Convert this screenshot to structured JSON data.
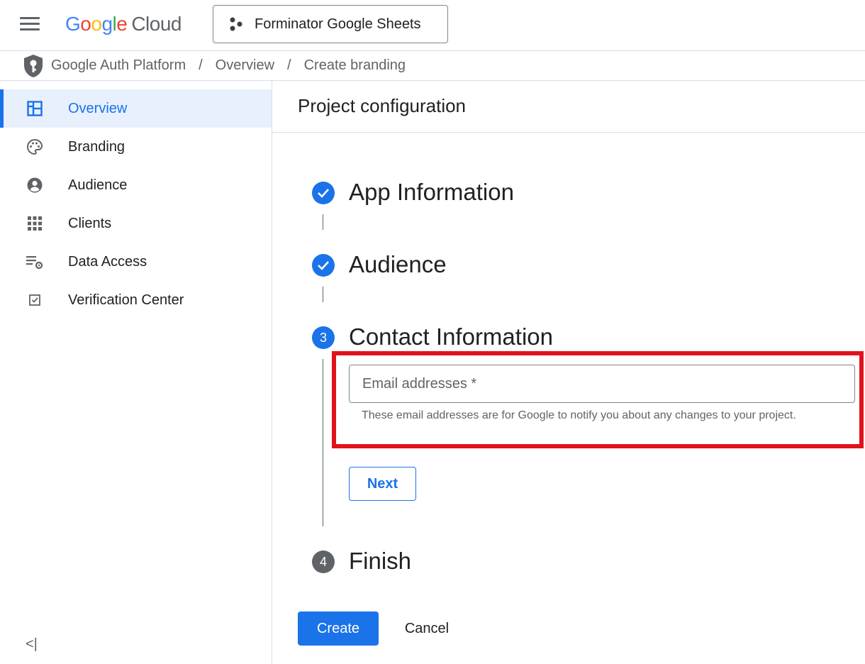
{
  "header": {
    "logo_google": "Google",
    "logo_cloud": "Cloud",
    "project_name": "Forminator Google Sheets"
  },
  "breadcrumb": {
    "items": [
      "Google Auth Platform",
      "Overview",
      "Create branding"
    ],
    "separator": "/"
  },
  "sidebar": {
    "items": [
      {
        "label": "Overview",
        "icon": "dashboard-icon",
        "active": true
      },
      {
        "label": "Branding",
        "icon": "palette-icon",
        "active": false
      },
      {
        "label": "Audience",
        "icon": "account-circle-icon",
        "active": false
      },
      {
        "label": "Clients",
        "icon": "apps-grid-icon",
        "active": false
      },
      {
        "label": "Data Access",
        "icon": "list-settings-icon",
        "active": false
      },
      {
        "label": "Verification Center",
        "icon": "checkbox-icon",
        "active": false
      }
    ],
    "collapse_label": "<|"
  },
  "main": {
    "title": "Project configuration",
    "steps": [
      {
        "number": "1",
        "label": "App Information",
        "status": "done"
      },
      {
        "number": "2",
        "label": "Audience",
        "status": "done"
      },
      {
        "number": "3",
        "label": "Contact Information",
        "status": "current"
      },
      {
        "number": "4",
        "label": "Finish",
        "status": "todo"
      }
    ],
    "email_field": {
      "placeholder": "Email addresses *",
      "value": "",
      "helper": "These email addresses are for Google to notify you about any changes to your project."
    },
    "next_label": "Next",
    "create_label": "Create",
    "cancel_label": "Cancel"
  },
  "colors": {
    "primary": "#1a73e8",
    "highlight": "#e0121b",
    "active_bg": "#e8f0fe"
  }
}
